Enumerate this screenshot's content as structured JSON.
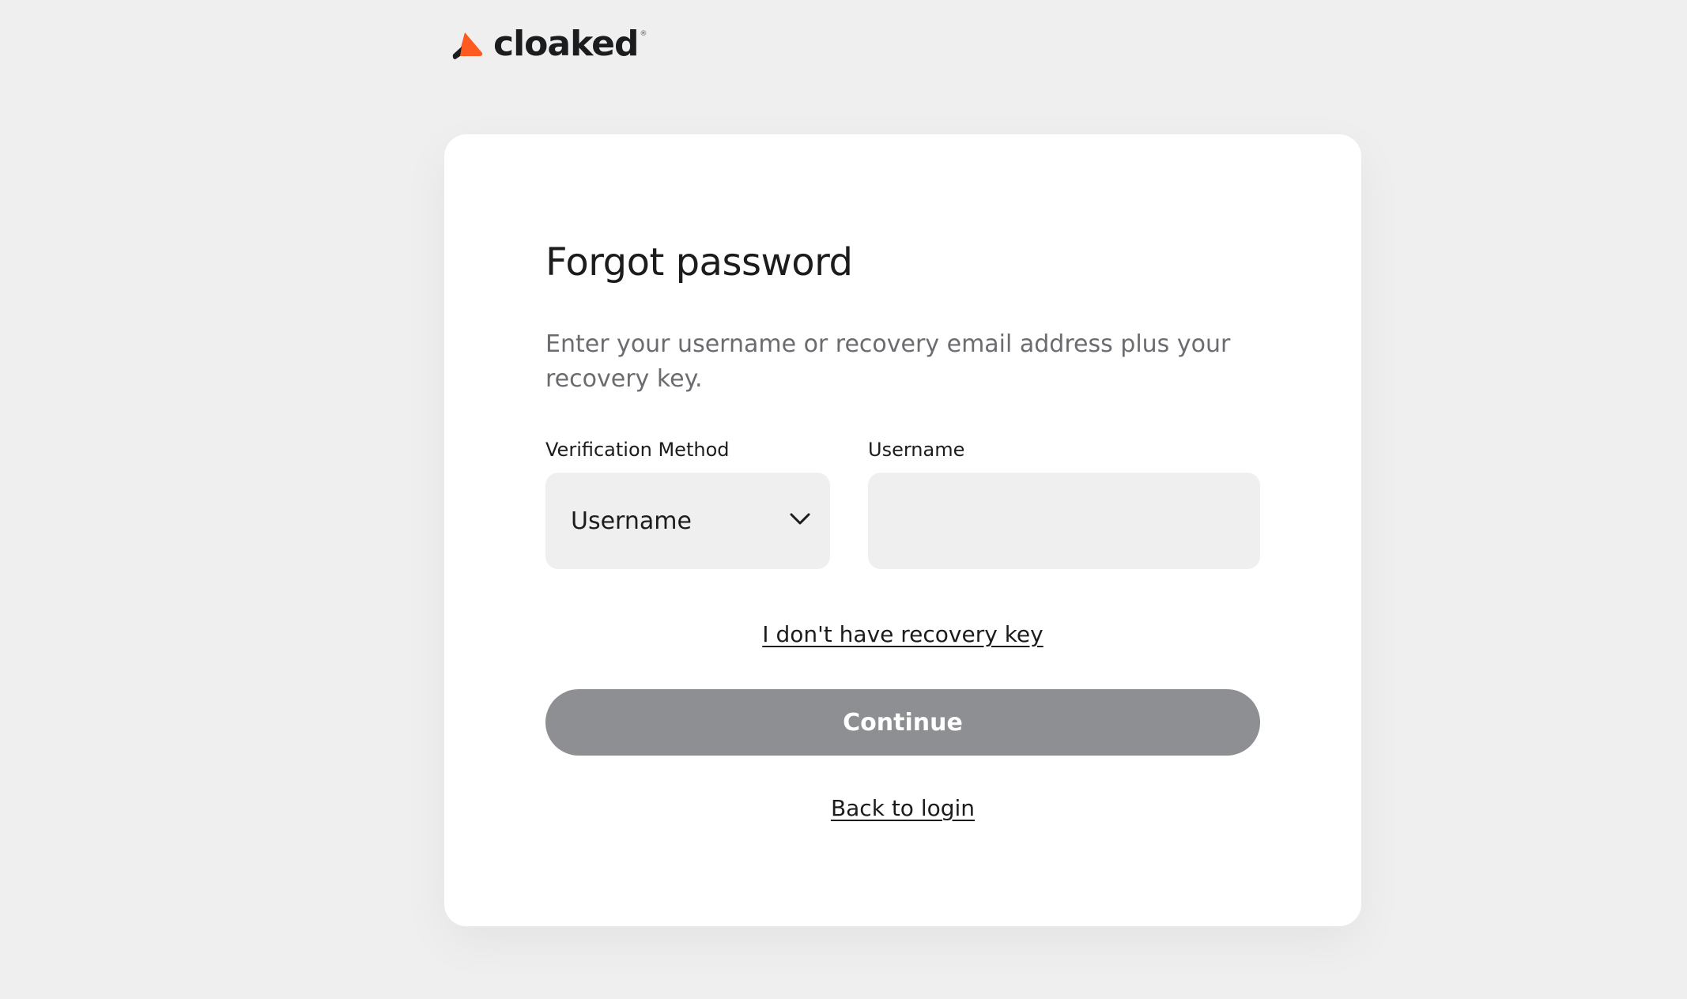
{
  "brand": {
    "name": "cloaked",
    "mark": "®",
    "accent_color": "#ff5a1f",
    "icon": "cloaked-logo-icon"
  },
  "form": {
    "title": "Forgot password",
    "description": "Enter your username or recovery email address plus your recovery key.",
    "verification_label": "Verification Method",
    "verification_value": "Username",
    "verification_icon": "chevron-down-icon",
    "username_label": "Username",
    "username_value": "",
    "username_placeholder": "",
    "no_recovery_link": "I don't have recovery key",
    "continue_label": "Continue",
    "continue_color": "#8e8f92",
    "back_link": "Back to login"
  }
}
